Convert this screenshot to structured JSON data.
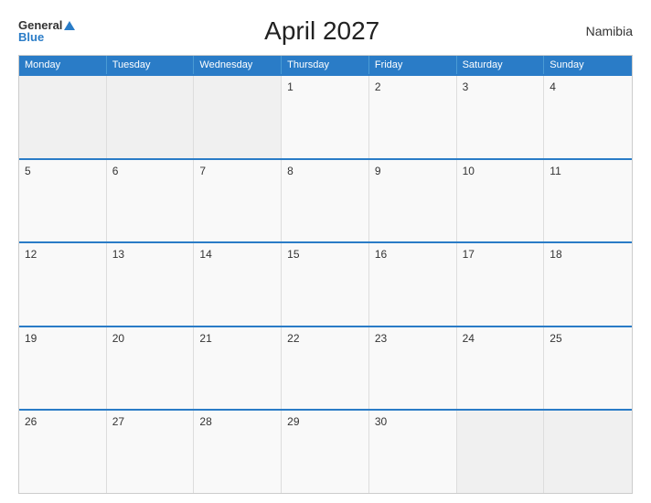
{
  "logo": {
    "general": "General",
    "blue": "Blue"
  },
  "title": "April 2027",
  "country": "Namibia",
  "headers": [
    "Monday",
    "Tuesday",
    "Wednesday",
    "Thursday",
    "Friday",
    "Saturday",
    "Sunday"
  ],
  "weeks": [
    [
      {
        "day": "",
        "empty": true
      },
      {
        "day": "",
        "empty": true
      },
      {
        "day": "",
        "empty": true
      },
      {
        "day": "1"
      },
      {
        "day": "2"
      },
      {
        "day": "3"
      },
      {
        "day": "4"
      }
    ],
    [
      {
        "day": "5"
      },
      {
        "day": "6"
      },
      {
        "day": "7"
      },
      {
        "day": "8"
      },
      {
        "day": "9"
      },
      {
        "day": "10"
      },
      {
        "day": "11"
      }
    ],
    [
      {
        "day": "12"
      },
      {
        "day": "13"
      },
      {
        "day": "14"
      },
      {
        "day": "15"
      },
      {
        "day": "16"
      },
      {
        "day": "17"
      },
      {
        "day": "18"
      }
    ],
    [
      {
        "day": "19"
      },
      {
        "day": "20"
      },
      {
        "day": "21"
      },
      {
        "day": "22"
      },
      {
        "day": "23"
      },
      {
        "day": "24"
      },
      {
        "day": "25"
      }
    ],
    [
      {
        "day": "26"
      },
      {
        "day": "27"
      },
      {
        "day": "28"
      },
      {
        "day": "29"
      },
      {
        "day": "30"
      },
      {
        "day": "",
        "empty": true
      },
      {
        "day": "",
        "empty": true
      }
    ]
  ]
}
